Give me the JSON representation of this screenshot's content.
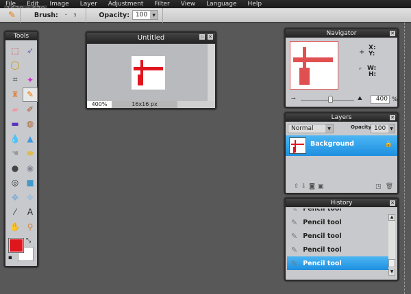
{
  "menu": [
    "File",
    "Edit",
    "Image",
    "Layer",
    "Adjustment",
    "Filter",
    "View",
    "Language",
    "Help"
  ],
  "dimension_tip": "1670 x 670",
  "toolbar": {
    "brush_label": "Brush:",
    "brush_size": "3",
    "opacity_label": "Opacity:",
    "opacity_value": "100"
  },
  "tools_panel": {
    "title": "Tools",
    "tools": [
      {
        "name": "marquee",
        "glyph": "⬚",
        "color": "#c44"
      },
      {
        "name": "move",
        "glyph": "➶",
        "color": "#66a"
      },
      {
        "name": "lasso",
        "glyph": "◯",
        "color": "#c90"
      },
      {
        "name": "empty",
        "glyph": "",
        "color": "#000"
      },
      {
        "name": "crop",
        "glyph": "⌗",
        "color": "#333"
      },
      {
        "name": "magic-wand",
        "glyph": "✦",
        "color": "#c3c"
      },
      {
        "name": "stamp",
        "glyph": "♜",
        "color": "#d84"
      },
      {
        "name": "pencil",
        "glyph": "✎",
        "color": "#e70"
      },
      {
        "name": "eraser",
        "glyph": "▰",
        "color": "#e9a"
      },
      {
        "name": "brush",
        "glyph": "✐",
        "color": "#a52"
      },
      {
        "name": "gradient",
        "glyph": "▬",
        "color": "#53b"
      },
      {
        "name": "paint-bucket",
        "glyph": "◍",
        "color": "#a63"
      },
      {
        "name": "blur",
        "glyph": "💧",
        "color": "#38c"
      },
      {
        "name": "sharpen",
        "glyph": "▲",
        "color": "#49d"
      },
      {
        "name": "smudge",
        "glyph": "☚",
        "color": "#999"
      },
      {
        "name": "sponge",
        "glyph": "⬬",
        "color": "#db5"
      },
      {
        "name": "burn",
        "glyph": "●",
        "color": "#444"
      },
      {
        "name": "red-eye",
        "glyph": "◉",
        "color": "#889"
      },
      {
        "name": "eye",
        "glyph": "◎",
        "color": "#333"
      },
      {
        "name": "rectangle",
        "glyph": "■",
        "color": "#49c"
      },
      {
        "name": "bloat",
        "glyph": "✥",
        "color": "#7ad"
      },
      {
        "name": "pinch",
        "glyph": "✥",
        "color": "#9bd"
      },
      {
        "name": "color-picker",
        "glyph": "⁄",
        "color": "#333"
      },
      {
        "name": "text",
        "glyph": "A",
        "color": "#222"
      },
      {
        "name": "hand",
        "glyph": "✋",
        "color": "#555"
      },
      {
        "name": "zoom",
        "glyph": "⚲",
        "color": "#c84"
      }
    ],
    "primary_color": "#e0161f",
    "secondary_color": "#ffffff"
  },
  "document": {
    "title": "Untitled",
    "zoom": "400%",
    "size": "16x16 px"
  },
  "navigator": {
    "title": "Navigator",
    "x_label": "X:",
    "y_label": "Y:",
    "w_label": "W:",
    "h_label": "H:",
    "zoom_value": "400",
    "percent": "%",
    "slider_fraction": 0.55
  },
  "layers": {
    "title": "Layers",
    "blend_mode": "Normal",
    "opacity_label": "Opacity:",
    "opacity_value": "100",
    "items": [
      {
        "name": "Background",
        "selected": true,
        "locked": true
      }
    ]
  },
  "history": {
    "title": "History",
    "items": [
      "Pencil tool",
      "Pencil tool",
      "Pencil tool",
      "Pencil tool",
      "Pencil tool"
    ],
    "selected_index": 4
  },
  "accent": "#2a9cea"
}
